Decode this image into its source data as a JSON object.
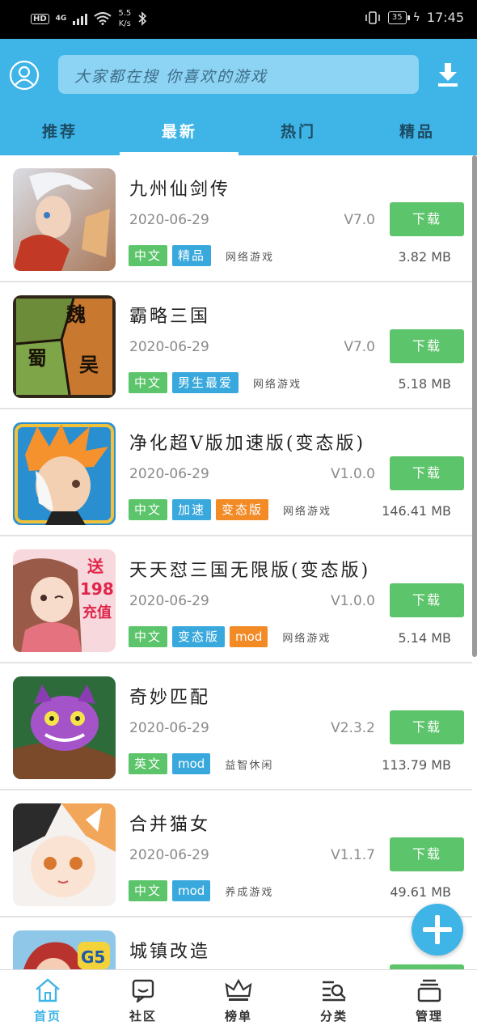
{
  "status_bar": {
    "hd": "HD",
    "network": "4G",
    "speed_value": "5.5",
    "speed_unit": "K/s",
    "battery": "35",
    "time": "17:45"
  },
  "header": {
    "search_placeholder": "大家都在搜  你喜欢的游戏",
    "tabs": [
      "推荐",
      "最新",
      "热门",
      "精品"
    ],
    "active_tab": "最新",
    "accent_color": "#3fb4e6"
  },
  "download_label": "下载",
  "games": [
    {
      "title": "九州仙剑传",
      "date": "2020-06-29",
      "version": "V7.0",
      "tags": [
        {
          "text": "中文",
          "color": "green"
        },
        {
          "text": "精品",
          "color": "blue"
        }
      ],
      "category": "网络游戏",
      "size": "3.82 MB"
    },
    {
      "title": "霸略三国",
      "date": "2020-06-29",
      "version": "V7.0",
      "tags": [
        {
          "text": "中文",
          "color": "green"
        },
        {
          "text": "男生最爱",
          "color": "blue"
        }
      ],
      "category": "网络游戏",
      "size": "5.18 MB",
      "icon_text": [
        "魏",
        "蜀",
        "吴"
      ]
    },
    {
      "title": "净化超V版加速版(变态版)",
      "date": "2020-06-29",
      "version": "V1.0.0",
      "tags": [
        {
          "text": "中文",
          "color": "green"
        },
        {
          "text": "加速",
          "color": "blue"
        },
        {
          "text": "变态版",
          "color": "orange"
        }
      ],
      "category": "网络游戏",
      "size": "146.41 MB"
    },
    {
      "title": "天天怼三国无限版(变态版)",
      "date": "2020-06-29",
      "version": "V1.0.0",
      "tags": [
        {
          "text": "中文",
          "color": "green"
        },
        {
          "text": "变态版",
          "color": "blue"
        },
        {
          "text": "mod",
          "color": "orange"
        }
      ],
      "category": "网络游戏",
      "size": "5.14 MB",
      "icon_text": [
        "送",
        "198",
        "充值"
      ]
    },
    {
      "title": "奇妙匹配",
      "date": "2020-06-29",
      "version": "V2.3.2",
      "tags": [
        {
          "text": "英文",
          "color": "green"
        },
        {
          "text": "mod",
          "color": "blue"
        }
      ],
      "category": "益智休闲",
      "size": "113.79 MB"
    },
    {
      "title": "合并猫女",
      "date": "2020-06-29",
      "version": "V1.1.7",
      "tags": [
        {
          "text": "中文",
          "color": "green"
        },
        {
          "text": "mod",
          "color": "blue"
        }
      ],
      "category": "养成游戏",
      "size": "49.61 MB"
    },
    {
      "title": "城镇改造",
      "icon_text": [
        "G5"
      ]
    }
  ],
  "bottom_nav": [
    {
      "label": "首页",
      "icon": "home-icon",
      "active": true
    },
    {
      "label": "社区",
      "icon": "community-icon",
      "active": false
    },
    {
      "label": "榜单",
      "icon": "crown-icon",
      "active": false
    },
    {
      "label": "分类",
      "icon": "category-icon",
      "active": false
    },
    {
      "label": "管理",
      "icon": "manage-icon",
      "active": false
    }
  ]
}
